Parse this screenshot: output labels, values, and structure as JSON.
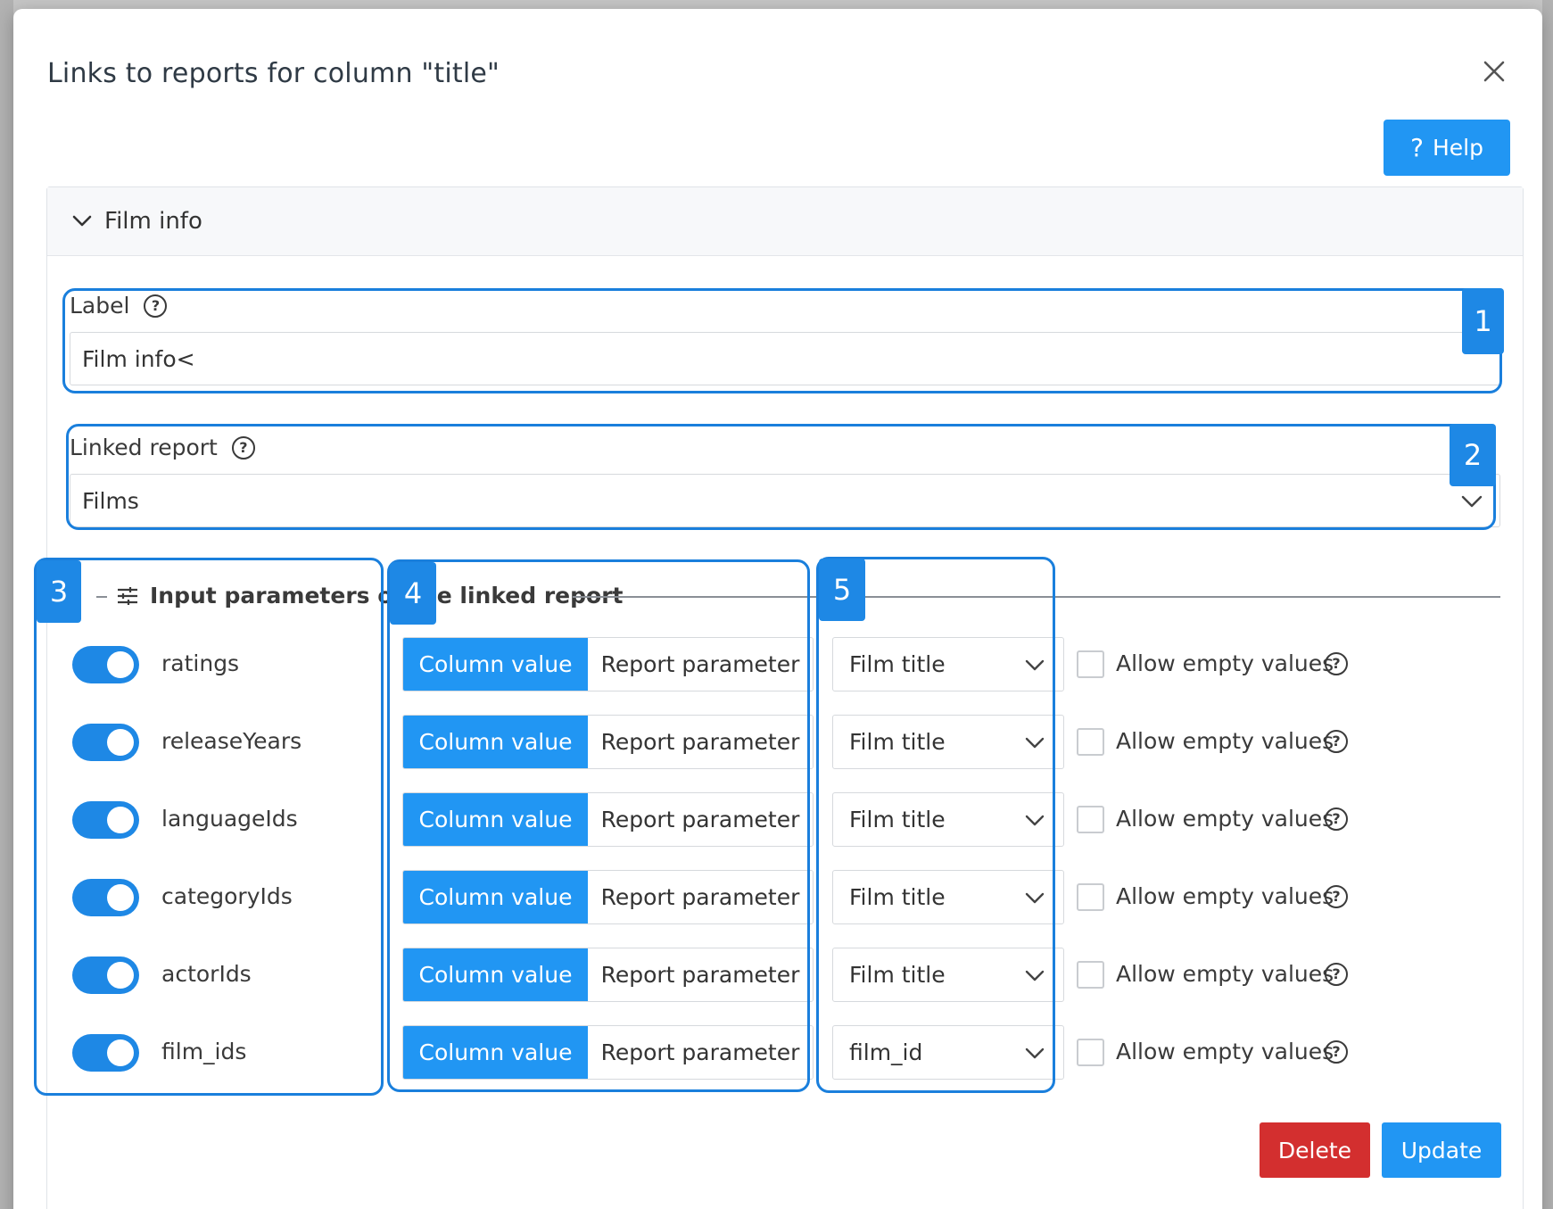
{
  "modal": {
    "title": "Links to reports for column \"title\"",
    "help_label": "Help",
    "close_icon": "close-icon"
  },
  "link": {
    "header_title": "Film info",
    "label_field": {
      "label": "Label",
      "value": "Film info<"
    },
    "linked_report": {
      "label": "Linked report",
      "value": "Films"
    },
    "params_section_title": "Input parameters of the linked report",
    "params": [
      {
        "name": "ratings",
        "mode_active": "Column value",
        "mode_inactive": "Report parameter",
        "column": "Film title",
        "allow_empty_label": "Allow empty values",
        "enabled": true,
        "allow_empty": false
      },
      {
        "name": "releaseYears",
        "mode_active": "Column value",
        "mode_inactive": "Report parameter",
        "column": "Film title",
        "allow_empty_label": "Allow empty values",
        "enabled": true,
        "allow_empty": false
      },
      {
        "name": "languageIds",
        "mode_active": "Column value",
        "mode_inactive": "Report parameter",
        "column": "Film title",
        "allow_empty_label": "Allow empty values",
        "enabled": true,
        "allow_empty": false
      },
      {
        "name": "categoryIds",
        "mode_active": "Column value",
        "mode_inactive": "Report parameter",
        "column": "Film title",
        "allow_empty_label": "Allow empty values",
        "enabled": true,
        "allow_empty": false
      },
      {
        "name": "actorIds",
        "mode_active": "Column value",
        "mode_inactive": "Report parameter",
        "column": "Film title",
        "allow_empty_label": "Allow empty values",
        "enabled": true,
        "allow_empty": false
      },
      {
        "name": "film_ids",
        "mode_active": "Column value",
        "mode_inactive": "Report parameter",
        "column": "film_id",
        "allow_empty_label": "Allow empty values",
        "enabled": true,
        "allow_empty": false
      }
    ],
    "delete_label": "Delete",
    "update_label": "Update"
  },
  "annotations": [
    "1",
    "2",
    "3",
    "4",
    "5"
  ],
  "colors": {
    "primary": "#2196f3",
    "danger": "#d32f2f",
    "annotation": "#1a7fdc"
  }
}
